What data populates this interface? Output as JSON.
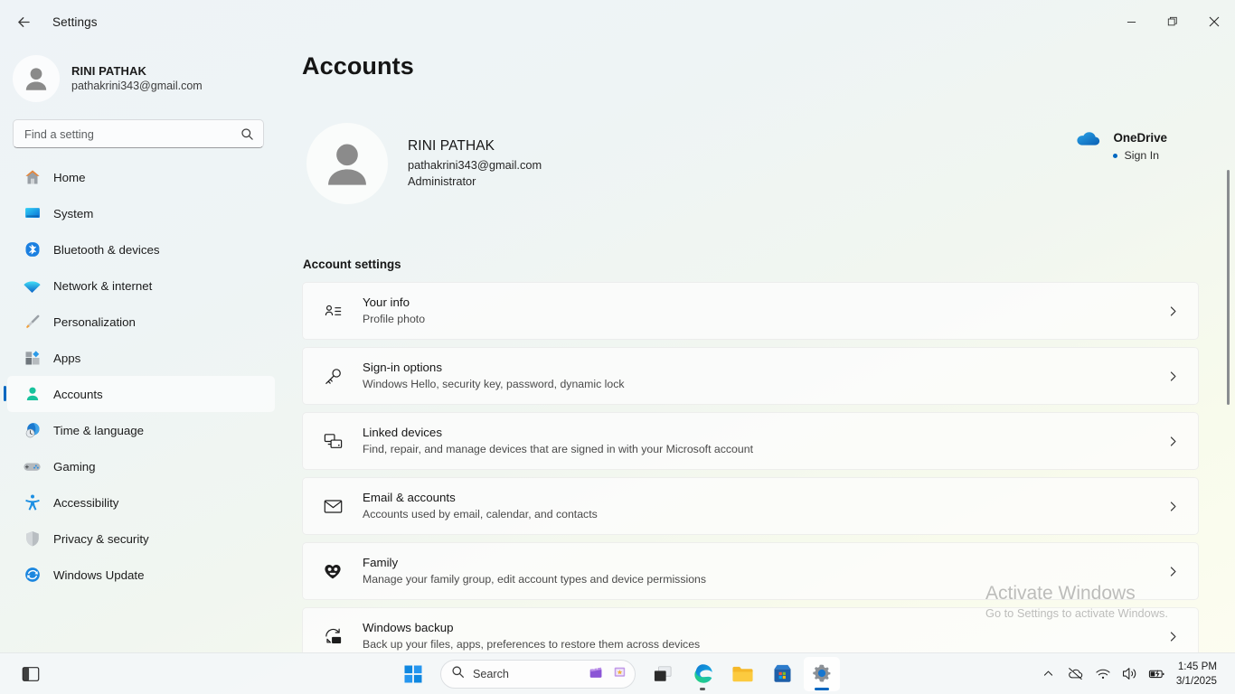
{
  "window": {
    "title": "Settings",
    "back_icon": "arrow-left-icon",
    "minimize_label": "–",
    "restore_label": "❐",
    "close_label": "✕"
  },
  "sidebar": {
    "profile": {
      "name": "RINI PATHAK",
      "email": "pathakrini343@gmail.com",
      "avatar_icon": "person-avatar-icon"
    },
    "search": {
      "placeholder": "Find a setting",
      "value": "",
      "icon": "search-icon"
    },
    "items": [
      {
        "label": "Home",
        "icon": "home-icon",
        "selected": false
      },
      {
        "label": "System",
        "icon": "monitor-icon",
        "selected": false
      },
      {
        "label": "Bluetooth & devices",
        "icon": "bluetooth-icon",
        "selected": false
      },
      {
        "label": "Network & internet",
        "icon": "wifi-icon",
        "selected": false
      },
      {
        "label": "Personalization",
        "icon": "paintbrush-icon",
        "selected": false
      },
      {
        "label": "Apps",
        "icon": "apps-grid-icon",
        "selected": false
      },
      {
        "label": "Accounts",
        "icon": "person-icon",
        "selected": true
      },
      {
        "label": "Time & language",
        "icon": "clock-globe-icon",
        "selected": false
      },
      {
        "label": "Gaming",
        "icon": "gamepad-icon",
        "selected": false
      },
      {
        "label": "Accessibility",
        "icon": "accessibility-person-icon",
        "selected": false
      },
      {
        "label": "Privacy & security",
        "icon": "shield-icon",
        "selected": false
      },
      {
        "label": "Windows Update",
        "icon": "update-refresh-icon",
        "selected": false
      }
    ]
  },
  "main": {
    "page_title": "Accounts",
    "account": {
      "name": "RINI PATHAK",
      "email": "pathakrini343@gmail.com",
      "role": "Administrator",
      "avatar_icon": "person-avatar-icon"
    },
    "onedrive": {
      "title": "OneDrive",
      "status": "Sign In",
      "icon": "onedrive-cloud-icon",
      "status_dot_color": "#0067c0"
    },
    "section_label": "Account settings",
    "cards": [
      {
        "title": "Your info",
        "subtitle": "Profile photo",
        "icon": "user-info-icon",
        "chevron": "chevron-right-icon"
      },
      {
        "title": "Sign-in options",
        "subtitle": "Windows Hello, security key, password, dynamic lock",
        "icon": "key-icon",
        "chevron": "chevron-right-icon"
      },
      {
        "title": "Linked devices",
        "subtitle": "Find, repair, and manage devices that are signed in with your Microsoft account",
        "icon": "linked-devices-icon",
        "chevron": "chevron-right-icon"
      },
      {
        "title": "Email & accounts",
        "subtitle": "Accounts used by email, calendar, and contacts",
        "icon": "envelope-icon",
        "chevron": "chevron-right-icon"
      },
      {
        "title": "Family",
        "subtitle": "Manage your family group, edit account types and device permissions",
        "icon": "family-heart-icon",
        "chevron": "chevron-right-icon"
      },
      {
        "title": "Windows backup",
        "subtitle": "Back up your files, apps, preferences to restore them across devices",
        "icon": "backup-icon",
        "chevron": "chevron-right-icon"
      }
    ]
  },
  "watermark": {
    "line1": "Activate Windows",
    "line2": "Go to Settings to activate Windows."
  },
  "taskbar": {
    "widgets_icon": "widgets-icon",
    "start_icon": "windows-start-icon",
    "search": {
      "label": "Search",
      "icon": "search-icon",
      "glyph1": "clapperboard-icon",
      "glyph2": "photo-icon"
    },
    "buttons": [
      {
        "name": "task-view",
        "icon": "task-view-icon"
      },
      {
        "name": "microsoft-edge",
        "icon": "edge-icon"
      },
      {
        "name": "file-explorer",
        "icon": "folder-icon"
      },
      {
        "name": "microsoft-store",
        "icon": "store-bag-icon"
      },
      {
        "name": "settings",
        "icon": "gear-icon"
      }
    ],
    "tray": [
      {
        "name": "show-hidden-icons",
        "icon": "chevron-up-icon"
      },
      {
        "name": "onedrive-paused",
        "icon": "cloud-slash-icon"
      },
      {
        "name": "network",
        "icon": "wifi-icon"
      },
      {
        "name": "volume",
        "icon": "speaker-icon"
      },
      {
        "name": "battery",
        "icon": "battery-charging-icon"
      }
    ],
    "clock": {
      "time": "1:45 PM",
      "date": "3/1/2025"
    }
  },
  "colors": {
    "accent": "#0067c0",
    "bg_top": "#eef3f7",
    "bg_bottom": "#fdfdf1"
  }
}
